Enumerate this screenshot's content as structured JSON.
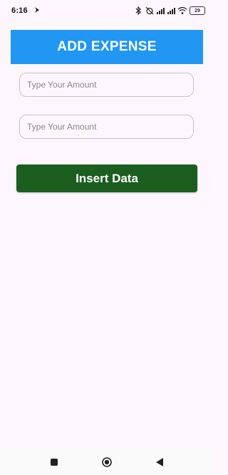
{
  "status_bar": {
    "time": "6:16",
    "battery": "29"
  },
  "header": {
    "title": "ADD EXPENSE"
  },
  "form": {
    "amount_placeholder_1": "Type Your Amount",
    "amount_placeholder_2": "Type Your Amount",
    "amount_value_1": "",
    "amount_value_2": "",
    "submit_label": "Insert Data"
  },
  "nav": {
    "items": [
      "recents-icon",
      "home-icon",
      "back-icon"
    ]
  },
  "colors": {
    "header_bg": "#2196f3",
    "button_bg": "#1b5e20",
    "page_bg": "#fdf6fd"
  }
}
